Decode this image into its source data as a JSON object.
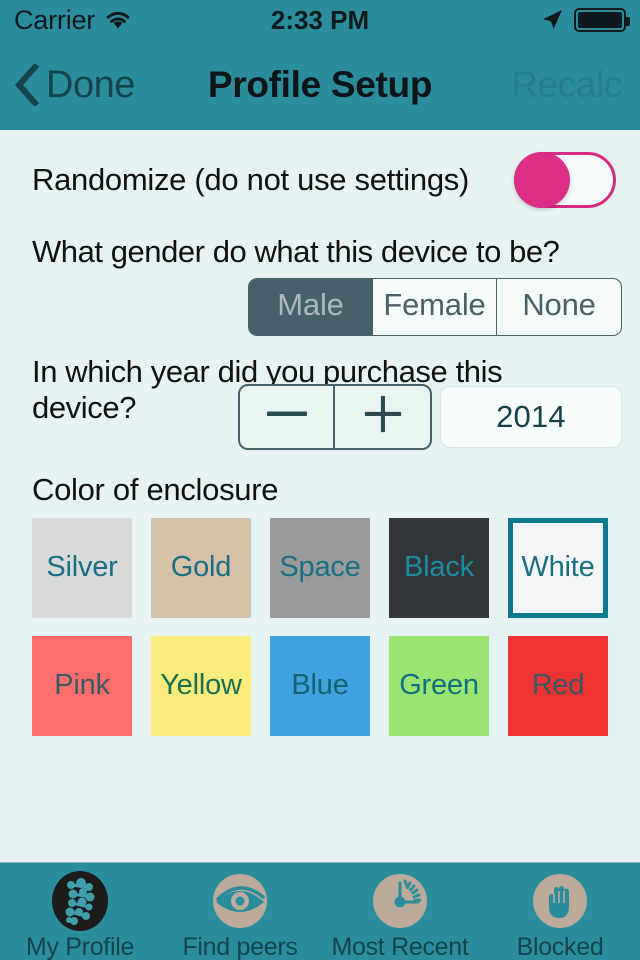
{
  "status_bar": {
    "carrier": "Carrier",
    "time": "2:33 PM",
    "wifi_icon": "wifi-icon",
    "location_icon": "location-arrow-icon",
    "battery_icon": "battery-full-icon"
  },
  "nav_bar": {
    "back_icon": "chevron-left-icon",
    "back_label": "Done",
    "title": "Profile Setup",
    "right_action_label": "Recalc",
    "bar_color": "#2b8d9c",
    "title_color": "#0c1517",
    "disabled_color": "#277f8e"
  },
  "form": {
    "randomize": {
      "label": "Randomize (do not use settings)",
      "toggle_state": "off",
      "toggle_accent_color": "#db2e84"
    },
    "gender": {
      "question": "What gender do what this device to be?",
      "options": [
        "Male",
        "Female",
        "None"
      ],
      "selected": "Male",
      "selected_bg": "#47616a",
      "selected_text_color": "#a9b9bd"
    },
    "year": {
      "question": "In which year did you purchase this device?",
      "decrement_label": "—",
      "increment_label": "+",
      "decrement_icon": "minus-icon",
      "increment_icon": "plus-icon",
      "value": "2014"
    },
    "color": {
      "question": "Color of enclosure",
      "selected": "White",
      "selection_border_color": "#0b7a8e",
      "swatches": [
        {
          "label": "Silver",
          "bg": "#d8dada",
          "text": "#1b6f83",
          "selected": false
        },
        {
          "label": "Gold",
          "bg": "#d6c0a8",
          "text": "#1b6f83",
          "selected": false
        },
        {
          "label": "Space",
          "bg": "#999a9b",
          "text": "#1b6f83",
          "selected": false
        },
        {
          "label": "Black",
          "bg": "#333639",
          "text": "#1b8ca0",
          "selected": false
        },
        {
          "label": "White",
          "bg": "#f5f7f7",
          "text": "#1b6f83",
          "selected": true
        },
        {
          "label": "Pink",
          "bg": "#fa6e6e",
          "text": "#3a5a62",
          "selected": false
        },
        {
          "label": "Yellow",
          "bg": "#f9ec7c",
          "text": "#1b6f4f",
          "selected": false
        },
        {
          "label": "Blue",
          "bg": "#3ea3de",
          "text": "#16626f",
          "selected": false
        },
        {
          "label": "Green",
          "bg": "#9ae571",
          "text": "#11707e",
          "selected": false
        },
        {
          "label": "Red",
          "bg": "#ef3333",
          "text": "#3a5a62",
          "selected": false
        }
      ]
    }
  },
  "tab_bar": {
    "bar_color": "#2b8d9c",
    "items": [
      {
        "label": "My Profile",
        "icon": "dna-helix-icon",
        "selected": true
      },
      {
        "label": "Find peers",
        "icon": "eye-icon",
        "selected": false
      },
      {
        "label": "Most Recent",
        "icon": "gauge-icon",
        "selected": false
      },
      {
        "label": "Blocked",
        "icon": "hand-stop-icon",
        "selected": false
      }
    ]
  }
}
